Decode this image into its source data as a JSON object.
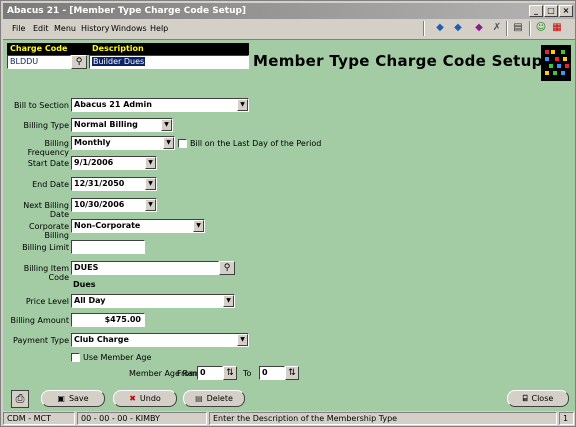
{
  "window": {
    "title": "Abacus 21 - [Member Type Charge Code Setup]"
  },
  "menu": [
    "File",
    "Edit",
    "Menu",
    "History",
    "Windows",
    "Help"
  ],
  "header": {
    "charge_code_label": "Charge Code",
    "charge_code_value": "BLDDU",
    "description_label": "Description",
    "description_value": "Builder Dues",
    "page_title": "Member Type Charge Code Setup"
  },
  "form": {
    "bill_to_section": {
      "label": "Bill to Section",
      "value": "Abacus 21 Admin"
    },
    "billing_type": {
      "label": "Billing Type",
      "value": "Normal Billing"
    },
    "billing_frequency": {
      "label": "Billing Frequency",
      "value": "Monthly"
    },
    "bill_last_day": {
      "label": "Bill on the Last Day of the Period",
      "checked": false
    },
    "start_date": {
      "label": "Start Date",
      "value": "9/1/2006"
    },
    "end_date": {
      "label": "End Date",
      "value": "12/31/2050"
    },
    "next_billing_date": {
      "label": "Next Billing Date",
      "value": "10/30/2006"
    },
    "corporate_billing": {
      "label": "Corporate Billing",
      "value": "Non-Corporate"
    },
    "billing_limit": {
      "label": "Billing Limit",
      "value": ""
    },
    "billing_item_code": {
      "label": "Billing Item Code",
      "value": "DUES",
      "description": "Dues"
    },
    "price_level": {
      "label": "Price Level",
      "value": "All Day"
    },
    "billing_amount": {
      "label": "Billing Amount",
      "value": "$475.00"
    },
    "payment_type": {
      "label": "Payment Type",
      "value": "Club Charge"
    },
    "use_member_age": {
      "label": "Use Member Age",
      "checked": false
    },
    "member_age_range": {
      "label": "Member Age Range",
      "from_label": "From",
      "from_value": "0",
      "to_label": "To",
      "to_value": "0"
    }
  },
  "buttons": {
    "save": "Save",
    "undo": "Undo",
    "delete": "Delete",
    "close": "Close"
  },
  "status": {
    "module": "CDM - MCT",
    "user": "00 - 00 - 00 - KIMBY",
    "message": "Enter the Description of the Membership Type",
    "page": "1"
  },
  "colors": {
    "form_background": "#a3cca5",
    "header_label_bg": "#000000",
    "header_label_fg": "#ffff00",
    "selection": "#0a246a"
  }
}
